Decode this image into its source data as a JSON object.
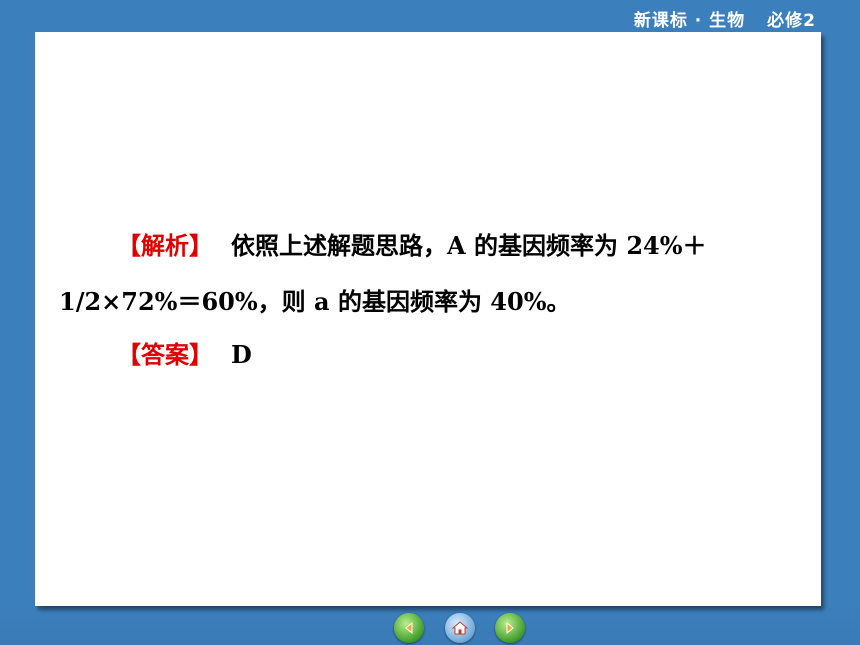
{
  "header": {
    "course": "新课标 · 生物",
    "volume": "必修2"
  },
  "content": {
    "analysis_tag": "【解析】",
    "analysis_line1": "依照上述解题思路，A 的基因频率为 24%＋",
    "analysis_line2": "1/2×72%＝60%，则 a 的基因频率为 40%。",
    "answer_tag": "【答案】",
    "answer_value": "D"
  },
  "nav": {
    "prev_icon": "left-arrow-icon",
    "home_icon": "home-icon",
    "next_icon": "right-arrow-icon"
  },
  "colors": {
    "background": "#3c7fbd",
    "slide": "#ffffff",
    "tag": "#e00000"
  }
}
